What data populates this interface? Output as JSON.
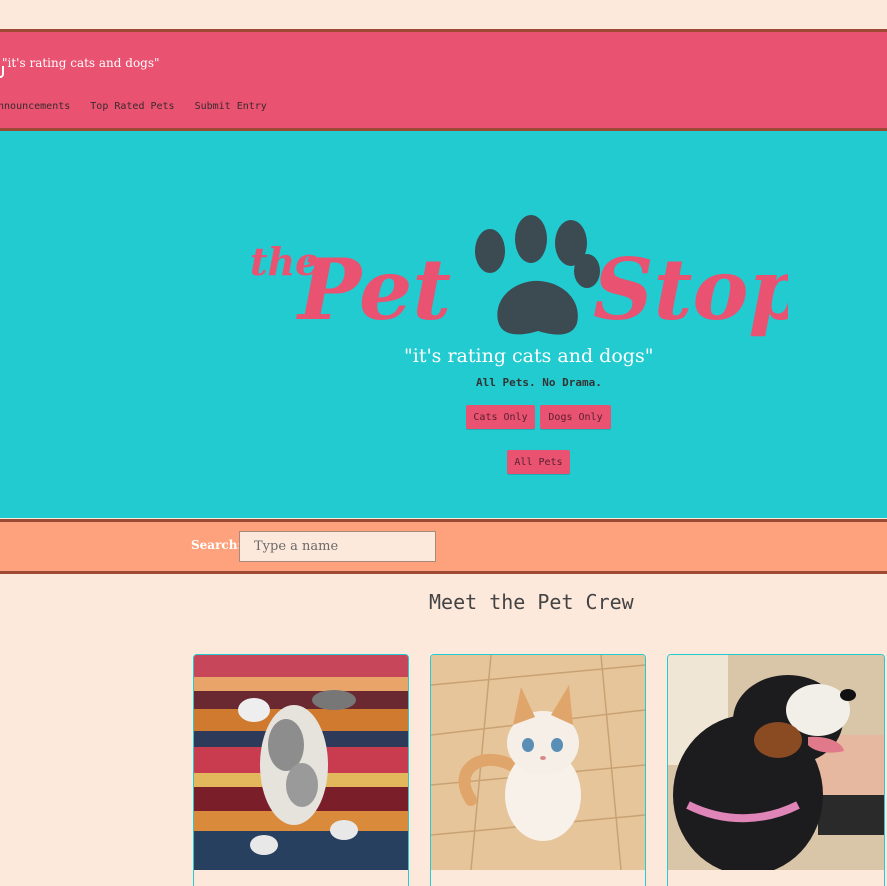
{
  "header": {
    "tagline": "\"it's rating cats and dogs\""
  },
  "nav": {
    "items": [
      {
        "label": "Announcements"
      },
      {
        "label": "Top Rated Pets"
      },
      {
        "label": "Submit Entry"
      }
    ]
  },
  "hero": {
    "logo_text": {
      "the": "the",
      "pet": "Pet",
      "stop": "Stop"
    },
    "tagline": "\"it's rating cats and dogs\"",
    "subtitle": "All Pets. No Drama.",
    "buttons": {
      "cats": "Cats Only",
      "dogs": "Dogs Only",
      "all": "All Pets"
    }
  },
  "search": {
    "label": "Search:",
    "placeholder": "Type a name"
  },
  "main": {
    "section_title": "Meet the Pet Crew"
  },
  "colors": {
    "header_bg": "#e95270",
    "hero_bg": "#22cbd0",
    "search_bg": "#fda27c",
    "page_bg": "#fde8dc",
    "border": "#9c4a34"
  }
}
